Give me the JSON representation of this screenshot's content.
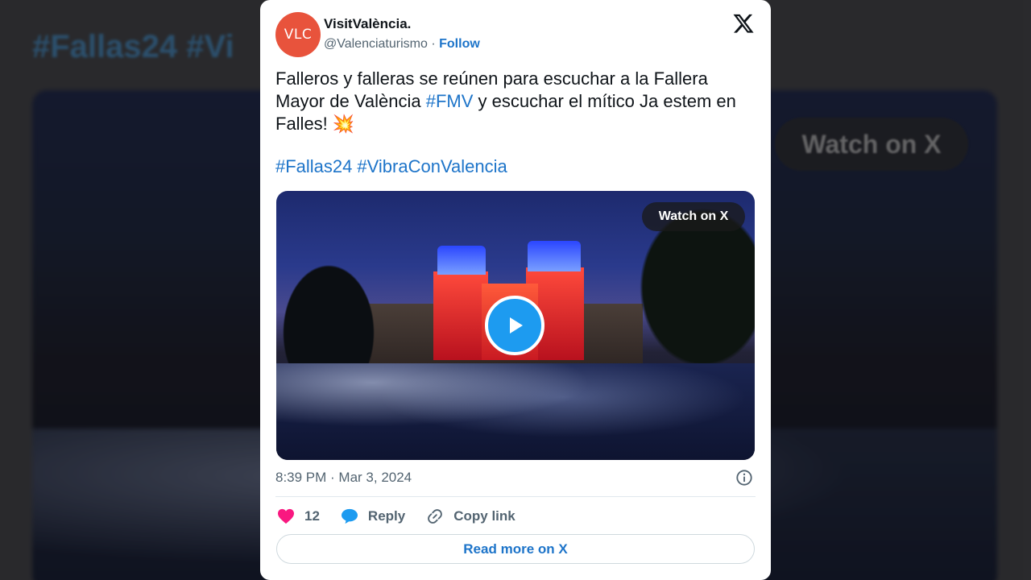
{
  "background": {
    "hashtags": "#Fallas24 #Vi",
    "watch_label": "Watch on X"
  },
  "tweet": {
    "avatar_text": "VLC",
    "display_name": "VisitValència.",
    "handle": "@Valenciaturismo",
    "separator": "·",
    "follow_label": "Follow",
    "text_part1": "Falleros y falleras se reúnen para escuchar a la Fallera Mayor de València ",
    "text_hashtag": "#FMV",
    "text_part2": " y escuchar el mítico Ja estem en Falles! ",
    "text_emoji": "💥",
    "hashtags": [
      "#Fallas24",
      "#VibraConValencia"
    ],
    "media_watch_label": "Watch on X",
    "timestamp": "8:39 PM · Mar 3, 2024",
    "like_count": "12",
    "reply_label": "Reply",
    "copy_link_label": "Copy link",
    "read_more_label": "Read more on X"
  },
  "colors": {
    "accent": "#1d9bf0",
    "link": "#1d74c9",
    "avatar_bg": "#e8533c",
    "like": "#f91880"
  },
  "icons": [
    "x-logo-icon",
    "play-icon",
    "info-icon",
    "heart-icon",
    "reply-bubble-icon",
    "link-icon"
  ]
}
